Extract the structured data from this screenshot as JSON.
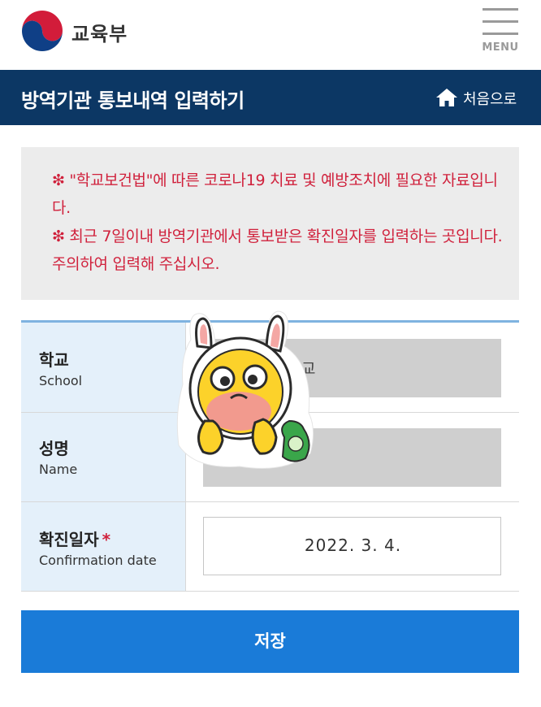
{
  "header": {
    "logo_text": "교육부",
    "menu_label": "MENU"
  },
  "titlebar": {
    "title": "방역기관 통보내역 입력하기",
    "home_label": "처음으로"
  },
  "notice": {
    "lines": [
      "❇ \"학교보건법\"에 따른 코로나19 치료 및 예방조치에 필요한 자료입니다.",
      "❇ 최근 7일이내 방역기관에서 통보받은 확진일자를 입력하는 곳입니다. 주의하여 입력해 주십시오."
    ]
  },
  "form": {
    "rows": [
      {
        "label_ko": "학교",
        "label_en": "School",
        "visible_value": "등학교"
      },
      {
        "label_ko": "성명",
        "label_en": "Name",
        "visible_value": ""
      },
      {
        "label_ko": "확진일자",
        "label_en": "Confirmation date",
        "required_mark": "*",
        "value": "2022. 3. 4."
      }
    ]
  },
  "save_label": "저장",
  "colors": {
    "header_navy": "#0c3764",
    "notice_red": "#d0213c",
    "label_bg": "#e4f0fa",
    "table_top_border": "#7fb3e0",
    "save_blue": "#1a7bd8"
  },
  "icons": [
    "moe-logo-icon",
    "menu-icon",
    "home-icon",
    "rabbit-sticker-icon"
  ]
}
